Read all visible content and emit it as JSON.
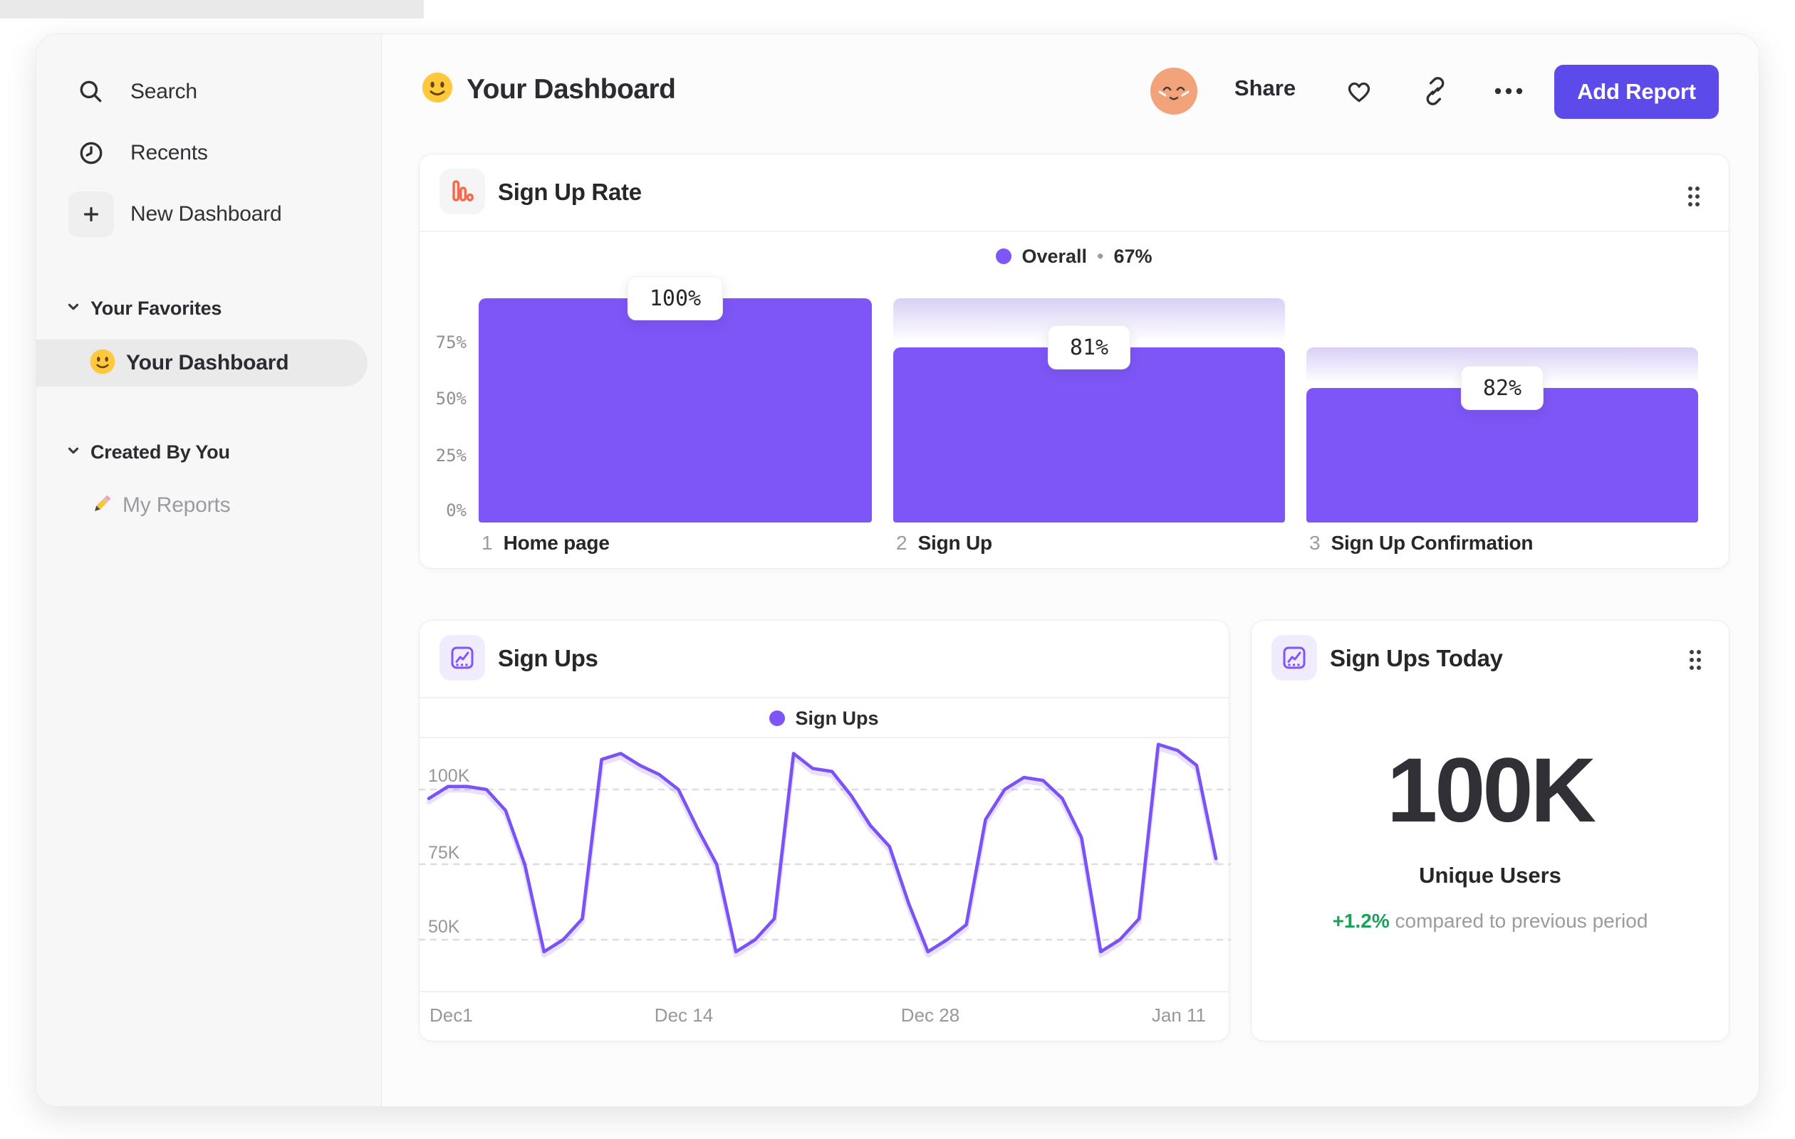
{
  "colors": {
    "accent_purple": "#7E55F7",
    "accent_indigo_button": "#5C4BE8",
    "funnel_icon_orange": "#F4694B",
    "delta_green": "#18A15C",
    "sidebar_bg": "#F7F7F7",
    "ghost_gradient_top": "#D9D0F6"
  },
  "sidebar": {
    "items": [
      {
        "label": "Search",
        "icon": "search-icon"
      },
      {
        "label": "Recents",
        "icon": "clock-icon"
      },
      {
        "label": "New Dashboard",
        "icon": "plus-icon"
      }
    ],
    "sections": [
      {
        "label": "Your Favorites",
        "items": [
          {
            "label": "Your Dashboard",
            "icon": "smiley-emoji",
            "selected": true
          }
        ]
      },
      {
        "label": "Created By You",
        "items": [
          {
            "label": "My Reports",
            "icon": "pencil-emoji",
            "selected": false
          }
        ]
      }
    ]
  },
  "header": {
    "title": "Your Dashboard",
    "title_emoji": "smiley-emoji",
    "avatar": "relieved-face-avatar",
    "share_label": "Share",
    "icons": [
      "heart-icon",
      "link-icon",
      "more-dots-icon"
    ],
    "add_report_label": "Add Report"
  },
  "chart_data": [
    {
      "type": "bar",
      "subtype": "funnel",
      "title": "Sign Up Rate",
      "legend": {
        "series": "Overall",
        "separator": "•",
        "overall_conversion": "67%"
      },
      "ylim": [
        0,
        100
      ],
      "y_ticks": [
        "0%",
        "25%",
        "50%",
        "75%"
      ],
      "steps": [
        {
          "step": "1",
          "name": "Home page",
          "label": "100%",
          "conversion_from_previous_pct": 100,
          "bar_height_pct": 100,
          "ghost_from_pct": 100
        },
        {
          "step": "2",
          "name": "Sign Up",
          "label": "81%",
          "conversion_from_previous_pct": 81,
          "bar_height_pct": 78,
          "ghost_from_pct": 100
        },
        {
          "step": "3",
          "name": "Sign Up Confirmation",
          "label": "82%",
          "conversion_from_previous_pct": 82,
          "bar_height_pct": 60,
          "ghost_from_pct": 78
        }
      ]
    },
    {
      "type": "line",
      "title": "Sign Ups",
      "series": [
        {
          "name": "Sign Ups",
          "values_thousands": [
            97,
            101,
            101,
            100,
            93,
            75,
            46,
            50,
            57,
            110,
            112,
            108,
            105,
            100,
            87,
            75,
            46,
            50,
            57,
            112,
            107,
            106,
            98,
            88,
            81,
            62,
            46,
            50,
            55,
            90,
            100,
            104,
            103,
            97,
            84,
            46,
            50,
            57,
            115,
            113,
            108,
            77
          ]
        }
      ],
      "x_tick_labels": [
        "Dec1",
        "Dec 14",
        "Dec 28",
        "Jan 11"
      ],
      "y_ticks": [
        "50K",
        "75K",
        "100K"
      ],
      "ylim_thousands": [
        40,
        117
      ],
      "grid": "dotted-horizontal",
      "legend_position": "top-center"
    },
    {
      "type": "big-number",
      "title": "Sign Ups Today",
      "value": "100K",
      "metric": "Unique Users",
      "delta": "+1.2%",
      "delta_note": "compared to previous period"
    }
  ]
}
